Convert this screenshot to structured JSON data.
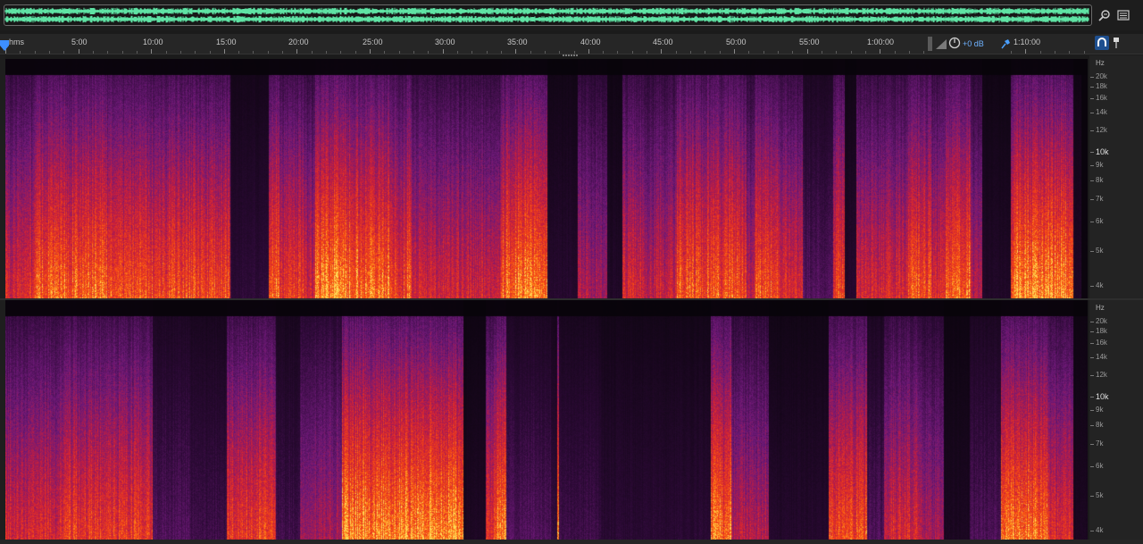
{
  "overview": {
    "zoom_icon": "zoom-magnifier-icon",
    "spectral_icon": "spectral-view-icon"
  },
  "ruler": {
    "units_label": "hms",
    "ticks": [
      "5:00",
      "10:00",
      "15:00",
      "20:00",
      "25:00",
      "30:00",
      "35:00",
      "40:00",
      "45:00",
      "50:00",
      "55:00",
      "1:00:00",
      "1:10:00"
    ]
  },
  "controls": {
    "gain_label": "+0 dB",
    "volume_icon": "volume-ramp-icon",
    "knob_icon": "gain-knob-icon",
    "pin_icon": "pin-icon",
    "magnet_icon": "snap-magnet-icon",
    "marker_icon": "marker-icon"
  },
  "freq_scale": {
    "unit": "Hz",
    "labels": [
      "20k",
      "18k",
      "16k",
      "14k",
      "12k",
      "10k",
      "9k",
      "8k",
      "7k",
      "6k",
      "5k",
      "4k"
    ],
    "major": "10k"
  },
  "colors": {
    "waveform": "#5fe3a4",
    "spec_low": "#0a0508",
    "spec_mid": "#6a1a78",
    "spec_high": "#ff6a10",
    "accent": "#2f8cff"
  }
}
